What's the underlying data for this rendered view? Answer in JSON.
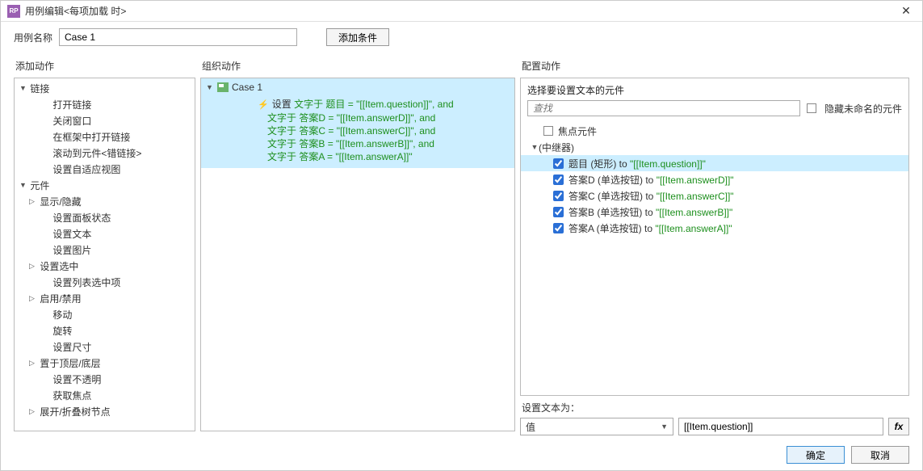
{
  "titlebar": {
    "app_abbr": "RP",
    "title": "用例编辑<每项加载 时>",
    "close": "✕"
  },
  "topbar": {
    "case_name_label": "用例名称",
    "case_name_value": "Case 1",
    "add_condition": "添加条件"
  },
  "headers": {
    "add_action": "添加动作",
    "organize_action": "组织动作",
    "configure_action": "配置动作"
  },
  "left_tree": {
    "links": {
      "label": "链接",
      "items": [
        "打开链接",
        "关闭窗口",
        "在框架中打开链接",
        "滚动到元件<错链接>",
        "设置自适应视图"
      ]
    },
    "widgets": {
      "label": "元件",
      "groups": [
        {
          "label": "显示/隐藏",
          "expanded": false
        },
        {
          "label": "设置面板状态",
          "leaf": true
        },
        {
          "label": "设置文本",
          "leaf": true
        },
        {
          "label": "设置图片",
          "leaf": true
        },
        {
          "label": "设置选中",
          "expanded": false
        },
        {
          "label": "设置列表选中项",
          "leaf": true
        },
        {
          "label": "启用/禁用",
          "expanded": false
        },
        {
          "label": "移动",
          "leaf": true
        },
        {
          "label": "旋转",
          "leaf": true
        },
        {
          "label": "设置尺寸",
          "leaf": true
        },
        {
          "label": "置于顶层/底层",
          "expanded": false
        },
        {
          "label": "设置不透明",
          "leaf": true
        },
        {
          "label": "获取焦点",
          "leaf": true
        },
        {
          "label": "展开/折叠树节点",
          "expanded": false
        }
      ]
    }
  },
  "mid": {
    "case_label": "Case 1",
    "set_prefix": "设置",
    "lines": [
      {
        "pre": "文字于 ",
        "target": "题目",
        "eq": " = ",
        "val": "\"[[Item.question]]\"",
        "tail": ", and"
      },
      {
        "pre": "文字于 ",
        "target": "答案D",
        "eq": " = ",
        "val": "\"[[Item.answerD]]\"",
        "tail": ", and"
      },
      {
        "pre": "文字于 ",
        "target": "答案C",
        "eq": " = ",
        "val": "\"[[Item.answerC]]\"",
        "tail": ", and"
      },
      {
        "pre": "文字于 ",
        "target": "答案B",
        "eq": " = ",
        "val": "\"[[Item.answerB]]\"",
        "tail": ", and"
      },
      {
        "pre": "文字于 ",
        "target": "答案A",
        "eq": " = ",
        "val": "\"[[Item.answerA]]\"",
        "tail": ""
      }
    ]
  },
  "right": {
    "subhead": "选择要设置文本的元件",
    "search_placeholder": "查找",
    "hide_unnamed_label": "隐藏未命名的元件",
    "focus_widget": "焦点元件",
    "repeater_label": "(中继器)",
    "items": [
      {
        "name": "题目 (矩形)",
        "to": " to ",
        "val": "\"[[Item.question]]\"",
        "selected": true
      },
      {
        "name": "答案D (单选按钮)",
        "to": " to ",
        "val": "\"[[Item.answerD]]\"",
        "selected": false
      },
      {
        "name": "答案C (单选按钮)",
        "to": " to ",
        "val": "\"[[Item.answerC]]\"",
        "selected": false
      },
      {
        "name": "答案B (单选按钮)",
        "to": " to ",
        "val": "\"[[Item.answerB]]\"",
        "selected": false
      },
      {
        "name": "答案A (单选按钮)",
        "to": " to ",
        "val": "\"[[Item.answerA]]\"",
        "selected": false
      }
    ],
    "set_text_label": "设置文本为：",
    "value_option": "值",
    "expr_value": "[[Item.question]]",
    "fx": "fx"
  },
  "footer": {
    "ok": "确定",
    "cancel": "取消"
  }
}
